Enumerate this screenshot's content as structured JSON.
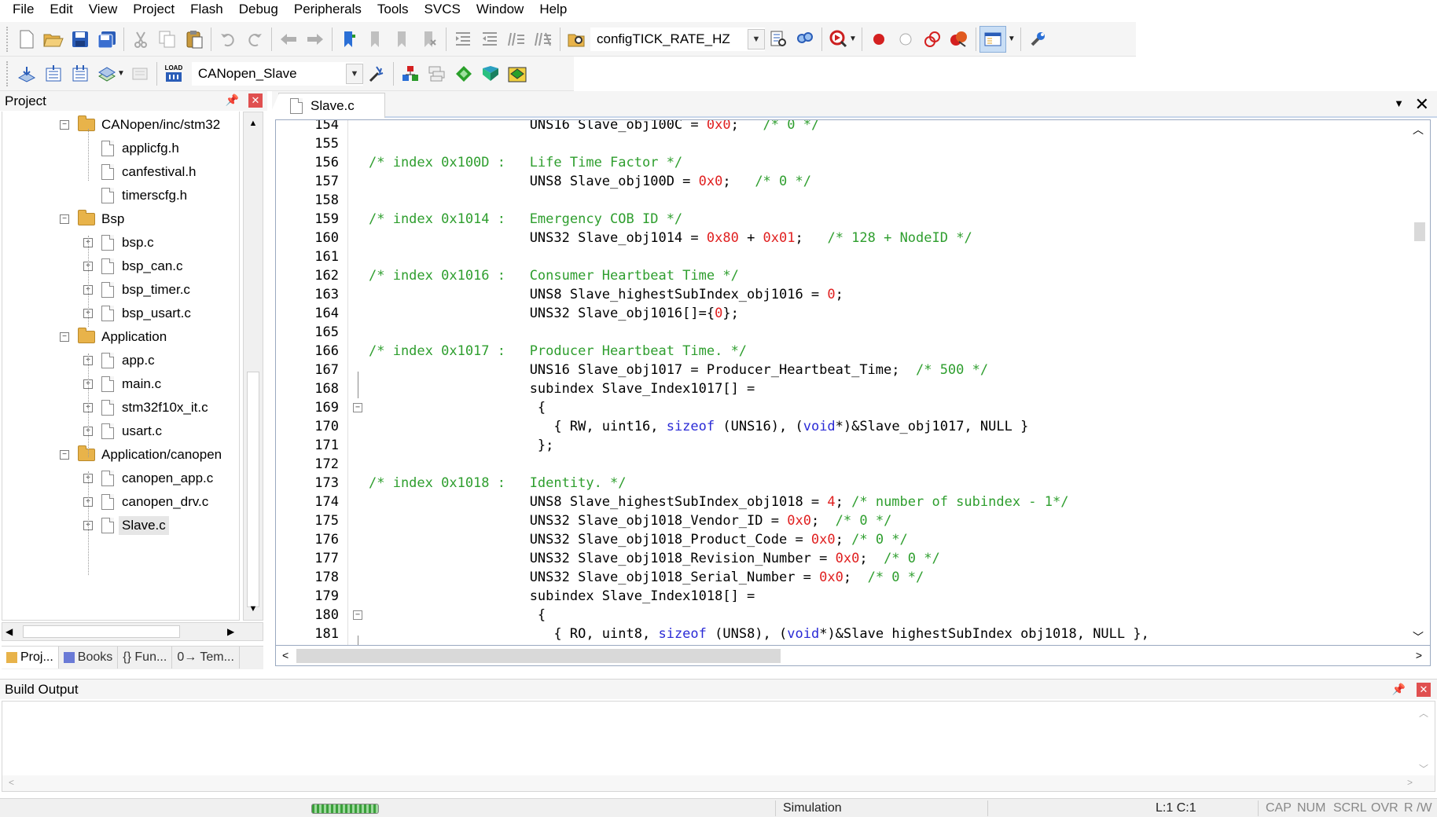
{
  "menu": [
    "File",
    "Edit",
    "View",
    "Project",
    "Flash",
    "Debug",
    "Peripherals",
    "Tools",
    "SVCS",
    "Window",
    "Help"
  ],
  "toolbar1": {
    "search_combo_value": "configTICK_RATE_HZ",
    "icons": [
      "new-file",
      "open-file",
      "save",
      "save-all",
      "cut",
      "copy",
      "paste",
      "undo",
      "redo",
      "navigate-back",
      "navigate-forward",
      "insert-bookmark",
      "previous-bookmark",
      "next-bookmark",
      "clear-bookmarks",
      "indent",
      "unindent",
      "comment",
      "uncomment",
      "find-in-files",
      "find",
      "incremental-find",
      "debug-start",
      "breakpoint-insert",
      "breakpoint-enable",
      "breakpoint-disable",
      "breakpoint-kill-all",
      "window-layout",
      "configure"
    ]
  },
  "toolbar2": {
    "target_combo_value": "CANopen_Slave",
    "load_label": "LOAD",
    "icons": [
      "translate",
      "build",
      "rebuild",
      "batch-build",
      "stop-build",
      "download",
      "target-options",
      "manage-project-items",
      "select-packs",
      "manage-run-time-environment",
      "pack-installer",
      "event-recorder"
    ]
  },
  "project_pane": {
    "title": "Project",
    "tree": [
      {
        "label": "CANopen/inc/stm32",
        "type": "folder",
        "level": 1,
        "expanded": true
      },
      {
        "label": "applicfg.h",
        "type": "file",
        "level": 2
      },
      {
        "label": "canfestival.h",
        "type": "file",
        "level": 2
      },
      {
        "label": "timerscfg.h",
        "type": "file",
        "level": 2
      },
      {
        "label": "Bsp",
        "type": "folder",
        "level": 1,
        "expanded": true
      },
      {
        "label": "bsp.c",
        "type": "file",
        "level": 2,
        "expandable": true
      },
      {
        "label": "bsp_can.c",
        "type": "file",
        "level": 2,
        "expandable": true
      },
      {
        "label": "bsp_timer.c",
        "type": "file",
        "level": 2,
        "expandable": true
      },
      {
        "label": "bsp_usart.c",
        "type": "file",
        "level": 2,
        "expandable": true
      },
      {
        "label": "Application",
        "type": "folder",
        "level": 1,
        "expanded": true
      },
      {
        "label": "app.c",
        "type": "file",
        "level": 2,
        "expandable": true
      },
      {
        "label": "main.c",
        "type": "file",
        "level": 2,
        "expandable": true
      },
      {
        "label": "stm32f10x_it.c",
        "type": "file",
        "level": 2,
        "expandable": true
      },
      {
        "label": "usart.c",
        "type": "file",
        "level": 2,
        "expandable": true
      },
      {
        "label": "Application/canopen",
        "type": "folder",
        "level": 1,
        "expanded": true
      },
      {
        "label": "canopen_app.c",
        "type": "file",
        "level": 2,
        "expandable": true
      },
      {
        "label": "canopen_drv.c",
        "type": "file",
        "level": 2,
        "expandable": true
      },
      {
        "label": "Slave.c",
        "type": "file",
        "level": 2,
        "expandable": true,
        "selected": true
      }
    ],
    "tabs": [
      "Proj...",
      "Books",
      "{} Fun...",
      "0→ Tem..."
    ]
  },
  "editor": {
    "tab_label": "Slave.c",
    "lines": [
      {
        "n": "154",
        "seg": [
          [
            "tx",
            "                    UNS16 Slave_obj100C = "
          ],
          [
            "num",
            "0x0"
          ],
          [
            "tx",
            ";   "
          ],
          [
            "cm",
            "/* 0 */"
          ]
        ]
      },
      {
        "n": "155",
        "seg": []
      },
      {
        "n": "156",
        "seg": [
          [
            "cm",
            "/* index 0x100D :   Life Time Factor */"
          ]
        ]
      },
      {
        "n": "157",
        "seg": [
          [
            "tx",
            "                    UNS8 Slave_obj100D = "
          ],
          [
            "num",
            "0x0"
          ],
          [
            "tx",
            ";   "
          ],
          [
            "cm",
            "/* 0 */"
          ]
        ]
      },
      {
        "n": "158",
        "seg": []
      },
      {
        "n": "159",
        "seg": [
          [
            "cm",
            "/* index 0x1014 :   Emergency COB ID */"
          ]
        ]
      },
      {
        "n": "160",
        "seg": [
          [
            "tx",
            "                    UNS32 Slave_obj1014 = "
          ],
          [
            "num",
            "0x80"
          ],
          [
            "tx",
            " + "
          ],
          [
            "num",
            "0x01"
          ],
          [
            "tx",
            ";   "
          ],
          [
            "cm",
            "/* 128 + NodeID */"
          ]
        ]
      },
      {
        "n": "161",
        "seg": []
      },
      {
        "n": "162",
        "seg": [
          [
            "cm",
            "/* index 0x1016 :   Consumer Heartbeat Time */"
          ]
        ]
      },
      {
        "n": "163",
        "seg": [
          [
            "tx",
            "                    UNS8 Slave_highestSubIndex_obj1016 = "
          ],
          [
            "num",
            "0"
          ],
          [
            "tx",
            ";"
          ]
        ]
      },
      {
        "n": "164",
        "seg": [
          [
            "tx",
            "                    UNS32 Slave_obj1016[]={"
          ],
          [
            "num",
            "0"
          ],
          [
            "tx",
            "};"
          ]
        ]
      },
      {
        "n": "165",
        "seg": []
      },
      {
        "n": "166",
        "seg": [
          [
            "cm",
            "/* index 0x1017 :   Producer Heartbeat Time. */"
          ]
        ]
      },
      {
        "n": "167",
        "seg": [
          [
            "tx",
            "                    UNS16 Slave_obj1017 = Producer_Heartbeat_Time;  "
          ],
          [
            "cm",
            "/* 500 */"
          ]
        ]
      },
      {
        "n": "168",
        "seg": [
          [
            "tx",
            "                    subindex Slave_Index1017[] ="
          ]
        ]
      },
      {
        "n": "169",
        "seg": [
          [
            "tx",
            "                     {"
          ]
        ],
        "fold": "-"
      },
      {
        "n": "170",
        "seg": [
          [
            "tx",
            "                       { RW, uint16, "
          ],
          [
            "kw",
            "sizeof"
          ],
          [
            "tx",
            " (UNS16), ("
          ],
          [
            "kw",
            "void"
          ],
          [
            "tx",
            "*)&Slave_obj1017, NULL }"
          ]
        ]
      },
      {
        "n": "171",
        "seg": [
          [
            "tx",
            "                     };"
          ]
        ]
      },
      {
        "n": "172",
        "seg": []
      },
      {
        "n": "173",
        "seg": [
          [
            "cm",
            "/* index 0x1018 :   Identity. */"
          ]
        ]
      },
      {
        "n": "174",
        "seg": [
          [
            "tx",
            "                    UNS8 Slave_highestSubIndex_obj1018 = "
          ],
          [
            "num",
            "4"
          ],
          [
            "tx",
            "; "
          ],
          [
            "cm",
            "/* number of subindex - 1*/"
          ]
        ]
      },
      {
        "n": "175",
        "seg": [
          [
            "tx",
            "                    UNS32 Slave_obj1018_Vendor_ID = "
          ],
          [
            "num",
            "0x0"
          ],
          [
            "tx",
            ";  "
          ],
          [
            "cm",
            "/* 0 */"
          ]
        ]
      },
      {
        "n": "176",
        "seg": [
          [
            "tx",
            "                    UNS32 Slave_obj1018_Product_Code = "
          ],
          [
            "num",
            "0x0"
          ],
          [
            "tx",
            "; "
          ],
          [
            "cm",
            "/* 0 */"
          ]
        ]
      },
      {
        "n": "177",
        "seg": [
          [
            "tx",
            "                    UNS32 Slave_obj1018_Revision_Number = "
          ],
          [
            "num",
            "0x0"
          ],
          [
            "tx",
            ";  "
          ],
          [
            "cm",
            "/* 0 */"
          ]
        ]
      },
      {
        "n": "178",
        "seg": [
          [
            "tx",
            "                    UNS32 Slave_obj1018_Serial_Number = "
          ],
          [
            "num",
            "0x0"
          ],
          [
            "tx",
            ";  "
          ],
          [
            "cm",
            "/* 0 */"
          ]
        ]
      },
      {
        "n": "179",
        "seg": [
          [
            "tx",
            "                    subindex Slave_Index1018[] ="
          ]
        ]
      },
      {
        "n": "180",
        "seg": [
          [
            "tx",
            "                     {"
          ]
        ],
        "fold": "-"
      },
      {
        "n": "181",
        "seg": [
          [
            "tx",
            "                       { RO, uint8, "
          ],
          [
            "kw",
            "sizeof"
          ],
          [
            "tx",
            " (UNS8), ("
          ],
          [
            "kw",
            "void"
          ],
          [
            "tx",
            "*)&Slave highestSubIndex obj1018, NULL },"
          ]
        ]
      }
    ]
  },
  "build_output": {
    "title": "Build Output"
  },
  "status": {
    "mode": "Simulation",
    "position": "L:1 C:1",
    "cap": "CAP",
    "num": "NUM",
    "scrl": "SCRL",
    "ovr": "OVR",
    "rw": "R /W"
  },
  "colors": {
    "comment": "#2e9e2e",
    "number": "#e02020",
    "keyword": "#2a2ad6"
  }
}
